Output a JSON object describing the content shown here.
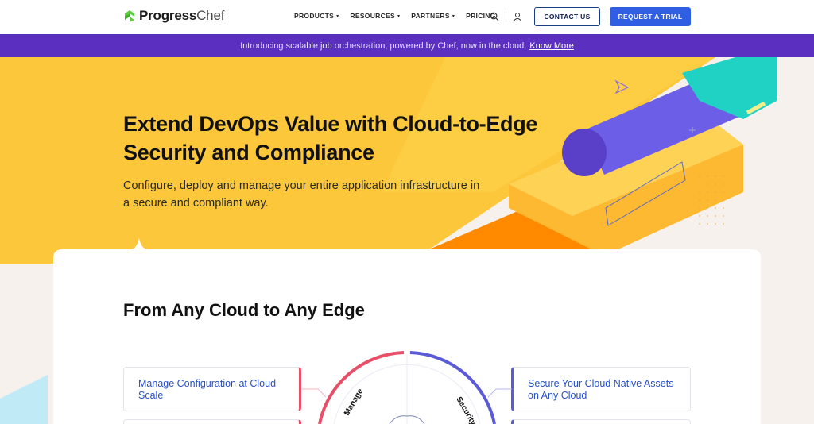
{
  "header": {
    "logo_brand": "Progress",
    "logo_product": "Chef",
    "nav": [
      {
        "label": "PRODUCTS"
      },
      {
        "label": "RESOURCES"
      },
      {
        "label": "PARTNERS"
      },
      {
        "label": "PRICING"
      }
    ],
    "contact_label": "CONTACT US",
    "trial_label": "REQUEST A TRIAL"
  },
  "announcement": {
    "text": "Introducing scalable job orchestration, powered by Chef, now in the cloud.",
    "link": "Know More"
  },
  "hero": {
    "title": "Extend DevOps Value with Cloud-to-Edge Security and Compliance",
    "subtitle": "Configure, deploy and manage your entire application infrastructure in a secure and compliant way."
  },
  "section": {
    "title": "From Any Cloud to Any Edge",
    "features_left": [
      "Manage Configuration at Cloud Scale"
    ],
    "features_right": [
      "Secure Your Cloud Native Assets on Any Cloud"
    ],
    "wheel_labels": [
      "Manage",
      "Security"
    ]
  },
  "colors": {
    "hero_yellow": "#fcc73a",
    "announce_purple": "#5b2fbf",
    "primary_blue": "#2f5ee2",
    "teal": "#1fd2c3",
    "orange": "#ff8a00"
  }
}
